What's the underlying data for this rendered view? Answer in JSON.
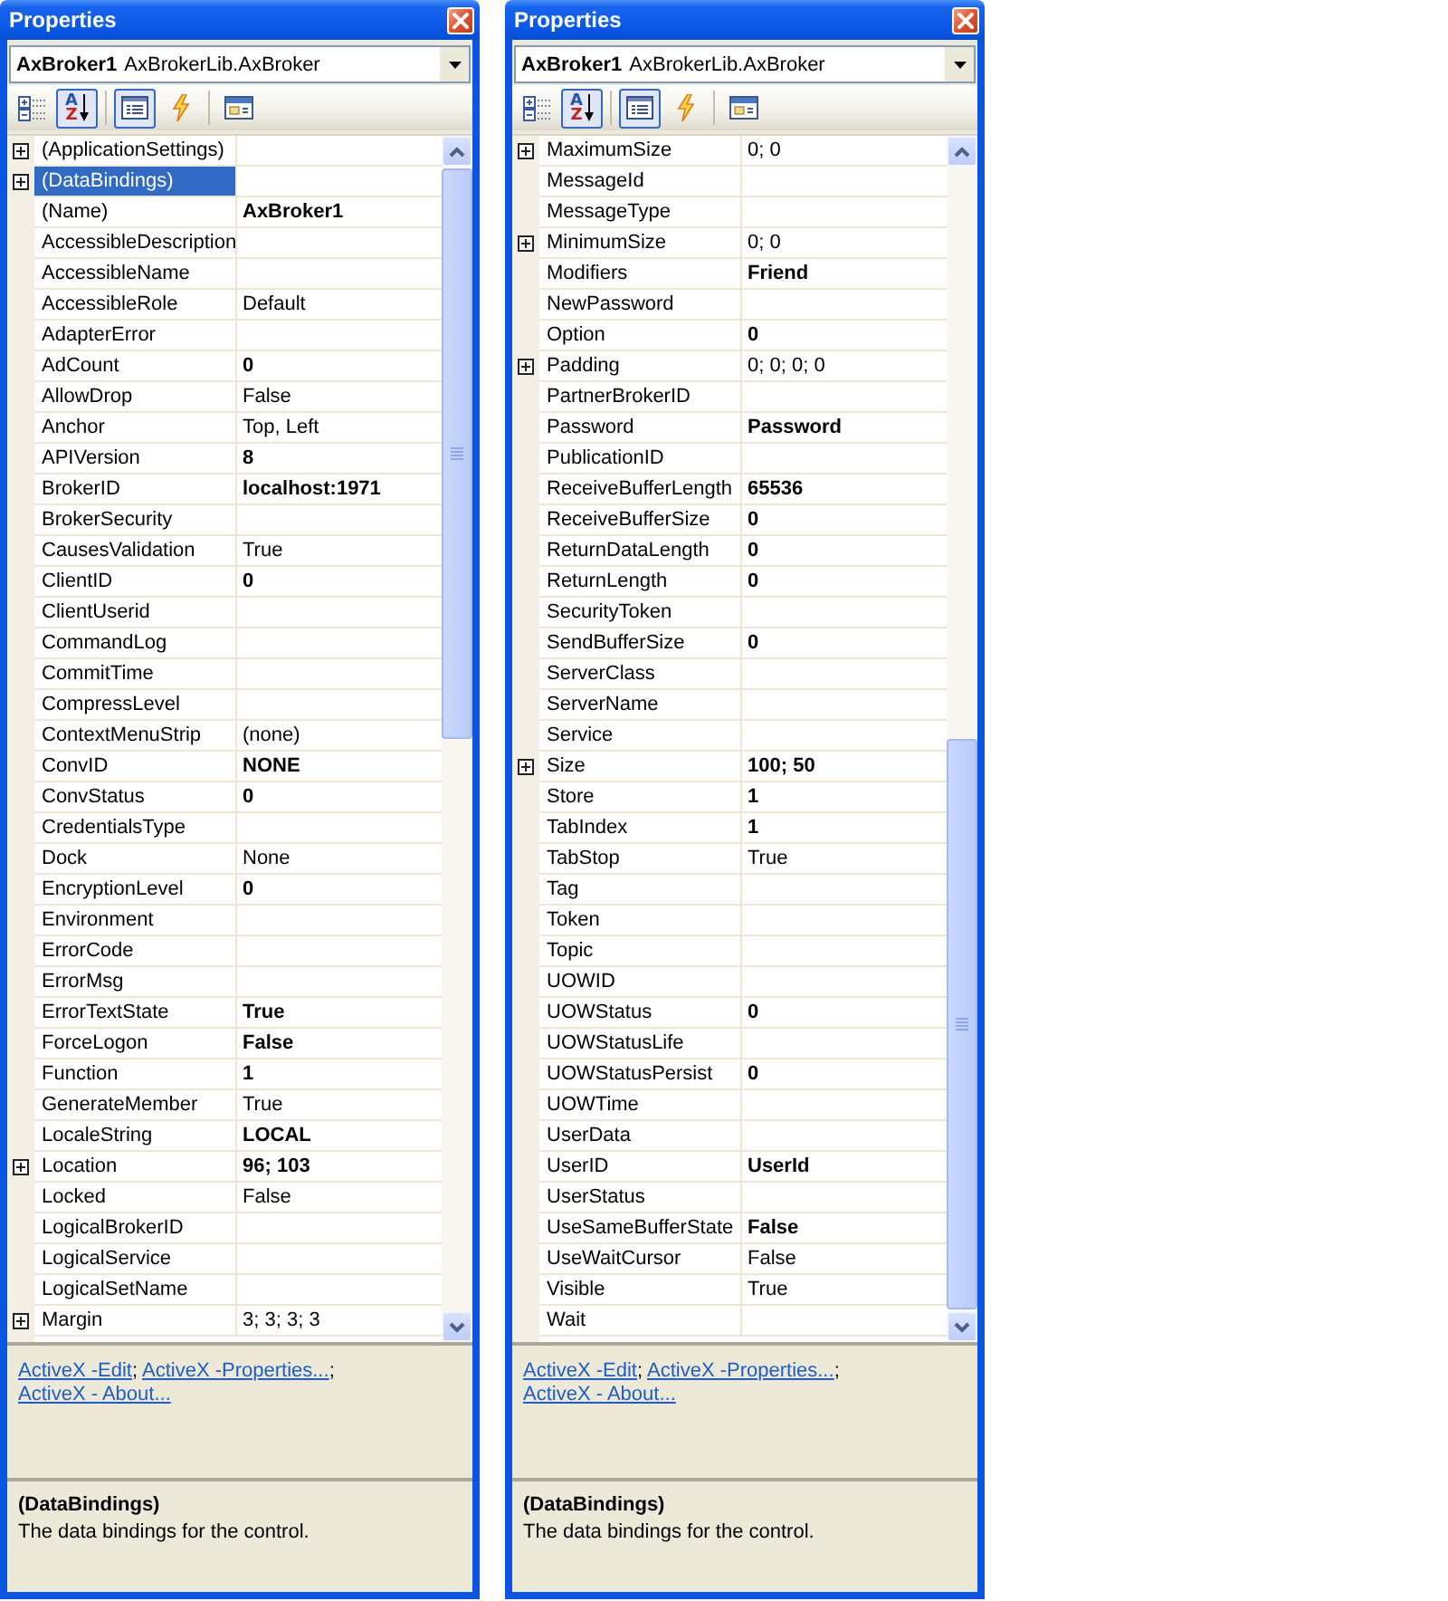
{
  "panels": [
    {
      "title": "Properties",
      "object_selector": {
        "name": "AxBroker1",
        "type": "AxBrokerLib.AxBroker"
      },
      "toolbar": {
        "groups": [
          {
            "buttons": [
              {
                "kind": "categorized",
                "selected": false
              },
              {
                "kind": "alphabetical",
                "selected": true,
                "letters": [
                  "A",
                  "Z"
                ]
              }
            ]
          },
          {
            "buttons": [
              {
                "kind": "properties",
                "selected": true
              },
              {
                "kind": "events",
                "selected": false
              }
            ]
          },
          {
            "buttons": [
              {
                "kind": "property_pages",
                "selected": false
              }
            ]
          }
        ]
      },
      "grid": {
        "scrolled_to_end": false,
        "rows": [
          {
            "name": "(ApplicationSettings)",
            "kind": "expandable",
            "selected": false
          },
          {
            "name": "(DataBindings)",
            "kind": "expandable",
            "selected": true
          },
          {
            "name": "(Name)",
            "kind": "plain",
            "selected": false,
            "value": "AxBroker1",
            "modified": true
          },
          {
            "name": "AccessibleDescription",
            "kind": "plain",
            "selected": false
          },
          {
            "name": "AccessibleName",
            "kind": "plain",
            "selected": false
          },
          {
            "name": "AccessibleRole",
            "kind": "plain",
            "selected": false,
            "value": "Default",
            "modified": false
          },
          {
            "name": "AdapterError",
            "kind": "plain",
            "selected": false
          },
          {
            "name": "AdCount",
            "kind": "plain",
            "selected": false,
            "value": "0",
            "modified": true
          },
          {
            "name": "AllowDrop",
            "kind": "plain",
            "selected": false,
            "value": "False",
            "modified": false
          },
          {
            "name": "Anchor",
            "kind": "plain",
            "selected": false,
            "value": "Top, Left",
            "modified": false
          },
          {
            "name": "APIVersion",
            "kind": "plain",
            "selected": false,
            "value": "8",
            "modified": true
          },
          {
            "name": "BrokerID",
            "kind": "plain",
            "selected": false,
            "value": "localhost:1971",
            "modified": true
          },
          {
            "name": "BrokerSecurity",
            "kind": "plain",
            "selected": false
          },
          {
            "name": "CausesValidation",
            "kind": "plain",
            "selected": false,
            "value": "True",
            "modified": false
          },
          {
            "name": "ClientID",
            "kind": "plain",
            "selected": false,
            "value": "0",
            "modified": true
          },
          {
            "name": "ClientUserid",
            "kind": "plain",
            "selected": false
          },
          {
            "name": "CommandLog",
            "kind": "plain",
            "selected": false
          },
          {
            "name": "CommitTime",
            "kind": "plain",
            "selected": false
          },
          {
            "name": "CompressLevel",
            "kind": "plain",
            "selected": false
          },
          {
            "name": "ContextMenuStrip",
            "kind": "plain",
            "selected": false,
            "value": "(none)",
            "modified": false
          },
          {
            "name": "ConvID",
            "kind": "plain",
            "selected": false,
            "value": "NONE",
            "modified": true
          },
          {
            "name": "ConvStatus",
            "kind": "plain",
            "selected": false,
            "value": "0",
            "modified": true
          },
          {
            "name": "CredentialsType",
            "kind": "plain",
            "selected": false
          },
          {
            "name": "Dock",
            "kind": "plain",
            "selected": false,
            "value": "None",
            "modified": false
          },
          {
            "name": "EncryptionLevel",
            "kind": "plain",
            "selected": false,
            "value": "0",
            "modified": true
          },
          {
            "name": "Environment",
            "kind": "plain",
            "selected": false
          },
          {
            "name": "ErrorCode",
            "kind": "plain",
            "selected": false
          },
          {
            "name": "ErrorMsg",
            "kind": "plain",
            "selected": false
          },
          {
            "name": "ErrorTextState",
            "kind": "plain",
            "selected": false,
            "value": "True",
            "modified": true
          },
          {
            "name": "ForceLogon",
            "kind": "plain",
            "selected": false,
            "value": "False",
            "modified": true
          },
          {
            "name": "Function",
            "kind": "plain",
            "selected": false,
            "value": "1",
            "modified": true
          },
          {
            "name": "GenerateMember",
            "kind": "plain",
            "selected": false,
            "value": "True",
            "modified": false
          },
          {
            "name": "LocaleString",
            "kind": "plain",
            "selected": false,
            "value": "LOCAL",
            "modified": true
          },
          {
            "name": "Location",
            "kind": "expandable",
            "selected": false,
            "value": "96; 103",
            "modified": true
          },
          {
            "name": "Locked",
            "kind": "plain",
            "selected": false,
            "value": "False",
            "modified": false
          },
          {
            "name": "LogicalBrokerID",
            "kind": "plain",
            "selected": false
          },
          {
            "name": "LogicalService",
            "kind": "plain",
            "selected": false
          },
          {
            "name": "LogicalSetName",
            "kind": "plain",
            "selected": false
          },
          {
            "name": "Margin",
            "kind": "expandable",
            "selected": false,
            "value": "3; 3; 3; 3",
            "modified": false
          }
        ]
      },
      "commands": {
        "links": [
          "ActiveX -Edit",
          "ActiveX -Properties...",
          "ActiveX - About..."
        ],
        "separator": ";"
      },
      "description": {
        "title": "(DataBindings)",
        "text": "The data bindings for the control."
      }
    },
    {
      "title": "Properties",
      "object_selector": {
        "name": "AxBroker1",
        "type": "AxBrokerLib.AxBroker"
      },
      "toolbar": {
        "groups": [
          {
            "buttons": [
              {
                "kind": "categorized",
                "selected": false
              },
              {
                "kind": "alphabetical",
                "selected": true,
                "letters": [
                  "A",
                  "Z"
                ]
              }
            ]
          },
          {
            "buttons": [
              {
                "kind": "properties",
                "selected": true
              },
              {
                "kind": "events",
                "selected": false
              }
            ]
          },
          {
            "buttons": [
              {
                "kind": "property_pages",
                "selected": false
              }
            ]
          }
        ]
      },
      "grid": {
        "scrolled_to_end": true,
        "rows": [
          {
            "name": "MaximumSize",
            "kind": "expandable",
            "selected": false,
            "value": "0; 0",
            "modified": false
          },
          {
            "name": "MessageId",
            "kind": "plain",
            "selected": false
          },
          {
            "name": "MessageType",
            "kind": "plain",
            "selected": false
          },
          {
            "name": "MinimumSize",
            "kind": "expandable",
            "selected": false,
            "value": "0; 0",
            "modified": false
          },
          {
            "name": "Modifiers",
            "kind": "plain",
            "selected": false,
            "value": "Friend",
            "modified": true
          },
          {
            "name": "NewPassword",
            "kind": "plain",
            "selected": false
          },
          {
            "name": "Option",
            "kind": "plain",
            "selected": false,
            "value": "0",
            "modified": true
          },
          {
            "name": "Padding",
            "kind": "expandable",
            "selected": false,
            "value": "0; 0; 0; 0",
            "modified": false
          },
          {
            "name": "PartnerBrokerID",
            "kind": "plain",
            "selected": false
          },
          {
            "name": "Password",
            "kind": "plain",
            "selected": false,
            "value": "Password",
            "modified": true
          },
          {
            "name": "PublicationID",
            "kind": "plain",
            "selected": false
          },
          {
            "name": "ReceiveBufferLength",
            "kind": "plain",
            "selected": false,
            "value": "65536",
            "modified": true
          },
          {
            "name": "ReceiveBufferSize",
            "kind": "plain",
            "selected": false,
            "value": "0",
            "modified": true
          },
          {
            "name": "ReturnDataLength",
            "kind": "plain",
            "selected": false,
            "value": "0",
            "modified": true
          },
          {
            "name": "ReturnLength",
            "kind": "plain",
            "selected": false,
            "value": "0",
            "modified": true
          },
          {
            "name": "SecurityToken",
            "kind": "plain",
            "selected": false
          },
          {
            "name": "SendBufferSize",
            "kind": "plain",
            "selected": false,
            "value": "0",
            "modified": true
          },
          {
            "name": "ServerClass",
            "kind": "plain",
            "selected": false
          },
          {
            "name": "ServerName",
            "kind": "plain",
            "selected": false
          },
          {
            "name": "Service",
            "kind": "plain",
            "selected": false
          },
          {
            "name": "Size",
            "kind": "expandable",
            "selected": false,
            "value": "100; 50",
            "modified": true
          },
          {
            "name": "Store",
            "kind": "plain",
            "selected": false,
            "value": "1",
            "modified": true
          },
          {
            "name": "TabIndex",
            "kind": "plain",
            "selected": false,
            "value": "1",
            "modified": true
          },
          {
            "name": "TabStop",
            "kind": "plain",
            "selected": false,
            "value": "True",
            "modified": false
          },
          {
            "name": "Tag",
            "kind": "plain",
            "selected": false
          },
          {
            "name": "Token",
            "kind": "plain",
            "selected": false
          },
          {
            "name": "Topic",
            "kind": "plain",
            "selected": false
          },
          {
            "name": "UOWID",
            "kind": "plain",
            "selected": false
          },
          {
            "name": "UOWStatus",
            "kind": "plain",
            "selected": false,
            "value": "0",
            "modified": true
          },
          {
            "name": "UOWStatusLife",
            "kind": "plain",
            "selected": false
          },
          {
            "name": "UOWStatusPersist",
            "kind": "plain",
            "selected": false,
            "value": "0",
            "modified": true
          },
          {
            "name": "UOWTime",
            "kind": "plain",
            "selected": false
          },
          {
            "name": "UserData",
            "kind": "plain",
            "selected": false
          },
          {
            "name": "UserID",
            "kind": "plain",
            "selected": false,
            "value": "UserId",
            "modified": true
          },
          {
            "name": "UserStatus",
            "kind": "plain",
            "selected": false
          },
          {
            "name": "UseSameBufferState",
            "kind": "plain",
            "selected": false,
            "value": "False",
            "modified": true
          },
          {
            "name": "UseWaitCursor",
            "kind": "plain",
            "selected": false,
            "value": "False",
            "modified": false
          },
          {
            "name": "Visible",
            "kind": "plain",
            "selected": false,
            "value": "True",
            "modified": false
          },
          {
            "name": "Wait",
            "kind": "plain",
            "selected": false
          }
        ]
      },
      "commands": {
        "links": [
          "ActiveX -Edit",
          "ActiveX -Properties...",
          "ActiveX - About..."
        ],
        "separator": ";"
      },
      "description": {
        "title": "(DataBindings)",
        "text": "The data bindings for the control."
      }
    }
  ]
}
